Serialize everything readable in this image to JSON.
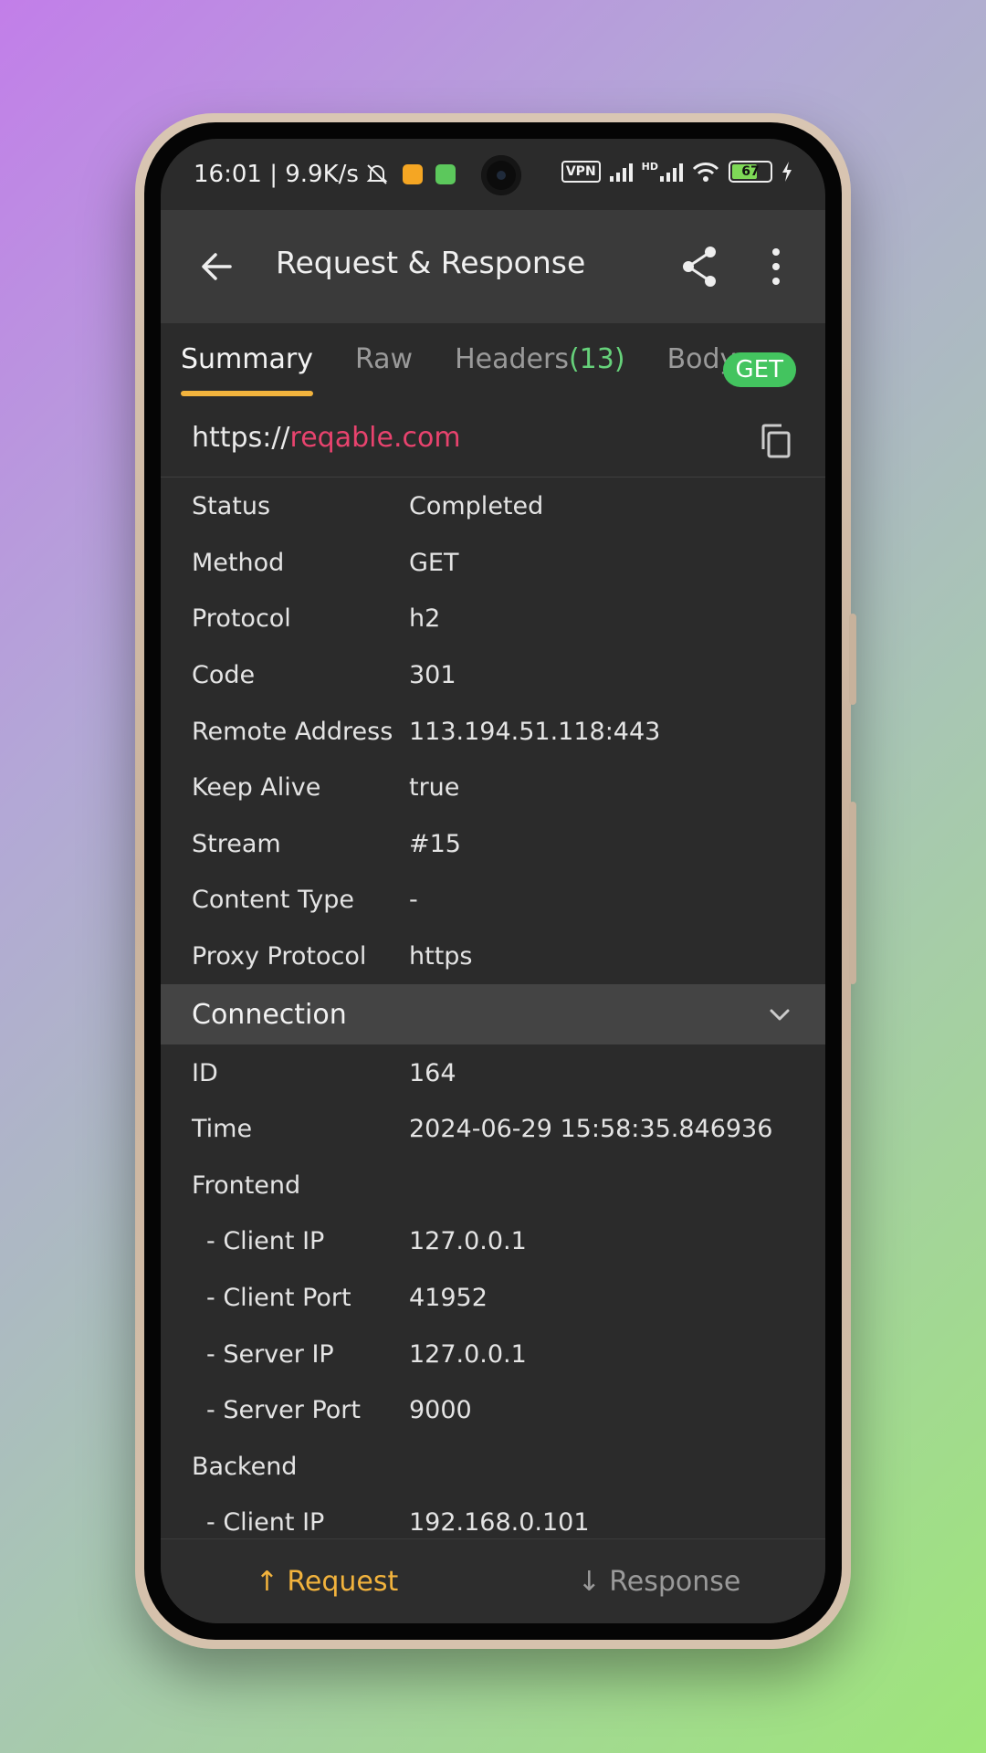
{
  "status_bar": {
    "time_speed": "16:01 | 9.9K/s",
    "vpn": "VPN",
    "hd": "HD",
    "battery": "67"
  },
  "appbar": {
    "title": "Request & Response"
  },
  "tabs": [
    {
      "label": "Summary"
    },
    {
      "label": "Raw"
    },
    {
      "label": "Headers",
      "count": "(13)"
    },
    {
      "label": "Body"
    }
  ],
  "method_badge": "GET",
  "url": {
    "scheme": "https://",
    "host": "reqable.com"
  },
  "summary_rows": [
    {
      "key": "Status",
      "value": "Completed"
    },
    {
      "key": "Method",
      "value": "GET"
    },
    {
      "key": "Protocol",
      "value": "h2"
    },
    {
      "key": "Code",
      "value": "301"
    },
    {
      "key": "Remote Address",
      "value": "113.194.51.118:443"
    },
    {
      "key": "Keep Alive",
      "value": "true"
    },
    {
      "key": "Stream",
      "value": "#15"
    },
    {
      "key": "Content Type",
      "value": "-"
    },
    {
      "key": "Proxy Protocol",
      "value": "https"
    }
  ],
  "connection": {
    "title": "Connection",
    "rows": [
      {
        "key": "ID",
        "value": "164"
      },
      {
        "key": "Time",
        "value": "2024-06-29 15:58:35.846936"
      },
      {
        "key": "Frontend",
        "value": ""
      },
      {
        "key": "- Client IP",
        "value": "127.0.0.1"
      },
      {
        "key": "- Client Port",
        "value": "41952"
      },
      {
        "key": "- Server IP",
        "value": "127.0.0.1"
      },
      {
        "key": "- Server Port",
        "value": "9000"
      },
      {
        "key": "Backend",
        "value": ""
      },
      {
        "key": "- Client IP",
        "value": "192.168.0.101"
      }
    ]
  },
  "bottom_bar": {
    "request": "↑ Request",
    "response": "↓ Response"
  },
  "colors": {
    "accent_tab": "#f2b33d",
    "host": "#e8436e",
    "get_badge": "#43c45f",
    "headers_count": "#66d17a"
  }
}
